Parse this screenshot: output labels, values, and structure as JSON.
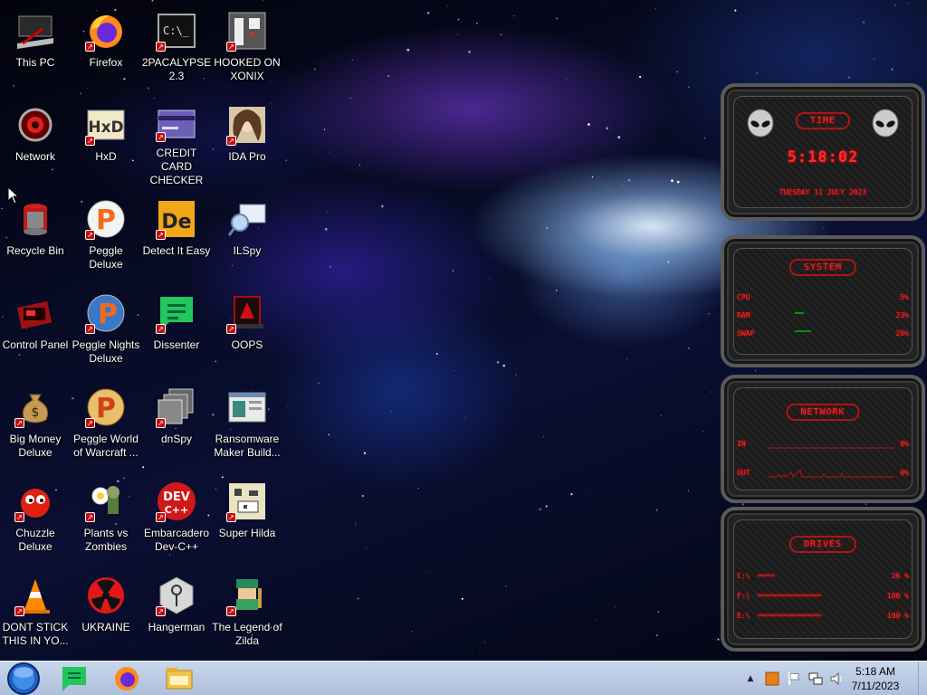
{
  "desktop": {
    "icons": [
      {
        "label": "This PC",
        "icon": "this-pc-icon"
      },
      {
        "label": "Firefox",
        "icon": "firefox-icon"
      },
      {
        "label": "2PACALYPSE 2.3",
        "icon": "terminal-icon"
      },
      {
        "label": "HOOKED ON XONIX",
        "icon": "xonix-icon"
      },
      {
        "label": "Network",
        "icon": "network-icon"
      },
      {
        "label": "HxD",
        "icon": "hxd-icon"
      },
      {
        "label": "CREDIT CARD CHECKER",
        "icon": "credit-card-icon"
      },
      {
        "label": "IDA Pro",
        "icon": "ida-pro-icon"
      },
      {
        "label": "Recycle Bin",
        "icon": "recycle-bin-icon"
      },
      {
        "label": "Peggle Deluxe",
        "icon": "peggle-icon"
      },
      {
        "label": "Detect It Easy",
        "icon": "detect-it-easy-icon"
      },
      {
        "label": "ILSpy",
        "icon": "ilspy-icon"
      },
      {
        "label": "Control Panel",
        "icon": "control-panel-icon"
      },
      {
        "label": "Peggle Nights Deluxe",
        "icon": "peggle-nights-icon"
      },
      {
        "label": "Dissenter",
        "icon": "dissenter-icon"
      },
      {
        "label": "OOPS",
        "icon": "oops-icon"
      },
      {
        "label": "Big Money Deluxe",
        "icon": "money-bag-icon"
      },
      {
        "label": "Peggle World of Warcraft ...",
        "icon": "peggle-wow-icon"
      },
      {
        "label": "dnSpy",
        "icon": "dnspy-icon"
      },
      {
        "label": "Ransomware Maker Build...",
        "icon": "ransomware-icon"
      },
      {
        "label": "Chuzzle Deluxe",
        "icon": "chuzzle-icon"
      },
      {
        "label": "Plants vs Zombies",
        "icon": "plants-vs-zombies-icon"
      },
      {
        "label": "Embarcadero Dev-C++",
        "icon": "dev-cpp-icon"
      },
      {
        "label": "Super Hilda",
        "icon": "super-hilda-icon"
      },
      {
        "label": "DONT STICK THIS IN YO...",
        "icon": "traffic-cone-icon"
      },
      {
        "label": "UKRAINE",
        "icon": "radiation-icon"
      },
      {
        "label": "Hangerman",
        "icon": "hangerman-icon"
      },
      {
        "label": "The Legend of Zilda",
        "icon": "zilda-icon"
      }
    ]
  },
  "widget": {
    "time": {
      "title": "TIME",
      "clock": "5:18:02",
      "date": "TUESDAY 11 JULY 2023"
    },
    "system": {
      "title": "SYSTEM",
      "rows": [
        {
          "label": "CPU",
          "value": "5%"
        },
        {
          "label": "RAM",
          "value": "23%"
        },
        {
          "label": "SWAP",
          "value": "20%"
        }
      ]
    },
    "network": {
      "title": "NETWORK",
      "rows": [
        {
          "label": "IN",
          "value": "0%"
        },
        {
          "label": "OUT",
          "value": "0%"
        }
      ]
    },
    "drives": {
      "title": "DRIVES",
      "rows": [
        {
          "label": "C:\\",
          "value": "26 %",
          "fill": 0.26
        },
        {
          "label": "F:\\",
          "value": "100 %",
          "fill": 1.0
        },
        {
          "label": "E:\\",
          "value": "100 %",
          "fill": 1.0
        }
      ]
    }
  },
  "taskbar": {
    "pinned": [
      {
        "icon": "start-orb-icon"
      },
      {
        "icon": "dissenter-icon"
      },
      {
        "icon": "firefox-icon"
      },
      {
        "icon": "file-explorer-icon"
      }
    ],
    "clock": {
      "time": "5:18 AM",
      "date": "7/11/2023"
    }
  }
}
